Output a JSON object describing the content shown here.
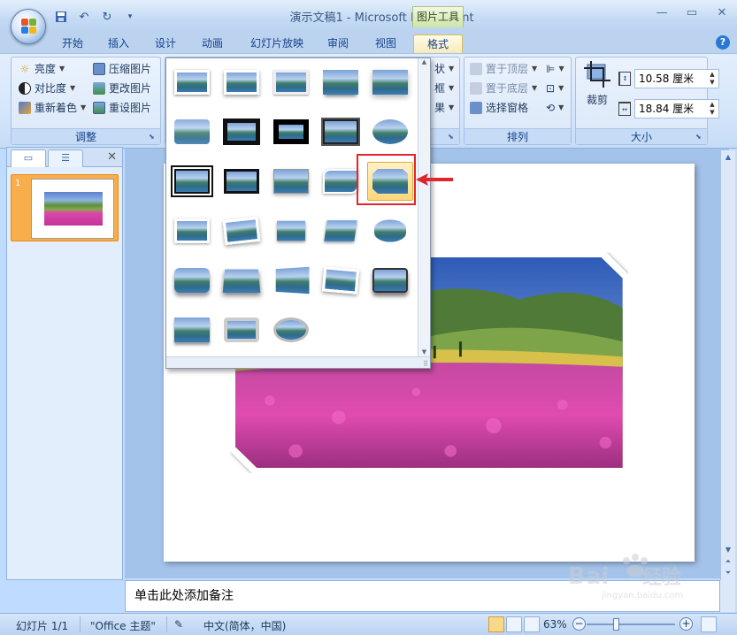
{
  "window": {
    "title": "演示文稿1 - Microsoft PowerPoint",
    "context_tool": "图片工具"
  },
  "quick_access": [
    "save-icon",
    "undo-icon",
    "redo-icon",
    "customize-icon"
  ],
  "tabs": [
    {
      "label": "开始",
      "active": false
    },
    {
      "label": "插入",
      "active": false
    },
    {
      "label": "设计",
      "active": false
    },
    {
      "label": "动画",
      "active": false
    },
    {
      "label": "幻灯片放映",
      "active": false
    },
    {
      "label": "审阅",
      "active": false
    },
    {
      "label": "视图",
      "active": false
    },
    {
      "label": "格式",
      "active": true
    }
  ],
  "ribbon": {
    "adjust": {
      "label": "调整",
      "brightness": "亮度",
      "contrast": "对比度",
      "recolor": "重新着色",
      "compress": "压缩图片",
      "change_picture": "更改图片",
      "reset_picture": "重设图片"
    },
    "styles_partial": {
      "shape": "状",
      "border": "框",
      "effects": "果"
    },
    "arrange": {
      "label": "排列",
      "bring_front": "置于顶层",
      "send_back": "置于底层",
      "selection_pane": "选择窗格"
    },
    "size": {
      "label": "大小",
      "crop": "裁剪",
      "height": "10.58 厘米",
      "width": "18.84 厘米"
    }
  },
  "slide_pane": {
    "slide_number": "1"
  },
  "notes": {
    "placeholder": "单击此处添加备注"
  },
  "status": {
    "slide_info": "幻灯片 1/1",
    "theme": "\"Office 主题\"",
    "language": "中文(简体，中国)",
    "zoom": "63%"
  },
  "watermark": {
    "brand": "Bai du 经验",
    "url": "jingyan.baidu.com"
  },
  "colors": {
    "accent_highlight": "#e0262b",
    "selected_item": "#ffd77a"
  }
}
